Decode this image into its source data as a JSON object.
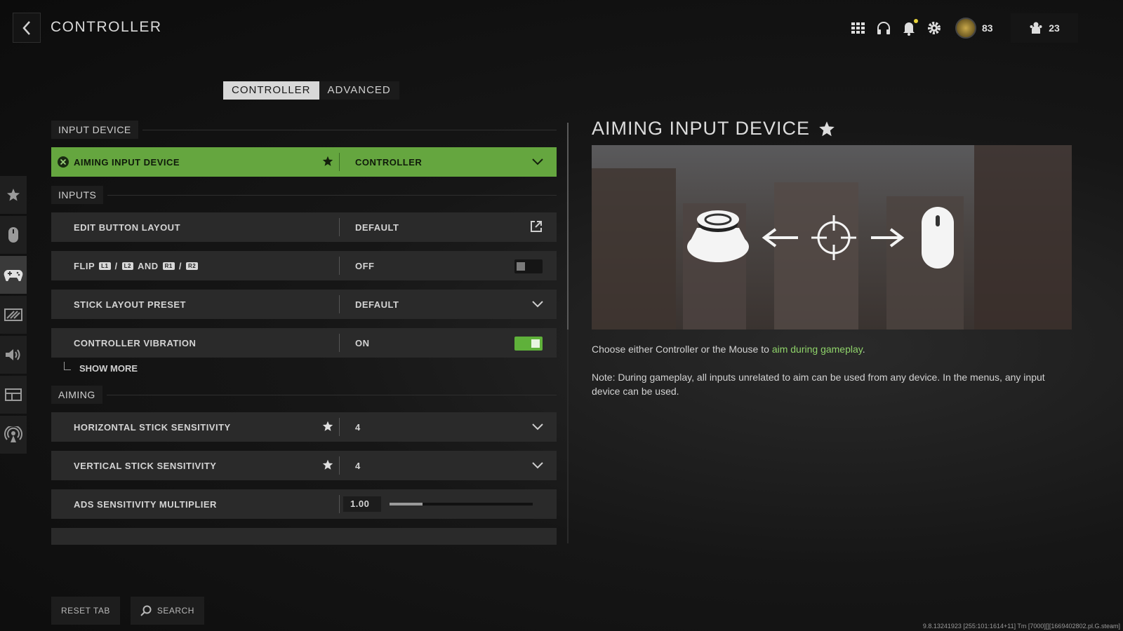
{
  "header": {
    "title": "CONTROLLER",
    "level": "83",
    "party_count": "23"
  },
  "tabs": [
    {
      "label": "CONTROLLER",
      "active": true
    },
    {
      "label": "ADVANCED",
      "active": false
    }
  ],
  "rail": [
    {
      "icon": "star-icon"
    },
    {
      "icon": "mouse-icon"
    },
    {
      "icon": "gamepad-icon",
      "active": true
    },
    {
      "icon": "display-icon"
    },
    {
      "icon": "speaker-icon"
    },
    {
      "icon": "interface-icon"
    },
    {
      "icon": "network-icon"
    }
  ],
  "sections": {
    "input_device": "INPUT DEVICE",
    "inputs": "INPUTS",
    "aiming": "AIMING"
  },
  "settings": {
    "aiming_input_device": {
      "label": "AIMING INPUT DEVICE",
      "value": "CONTROLLER"
    },
    "edit_button_layout": {
      "label": "EDIT BUTTON LAYOUT",
      "value": "DEFAULT"
    },
    "flip": {
      "prefix": "FLIP",
      "b1": "L1",
      "sep1": "/",
      "b2": "L2",
      "and": "AND",
      "b3": "R1",
      "sep2": "/",
      "b4": "R2",
      "value": "OFF"
    },
    "stick_layout_preset": {
      "label": "STICK LAYOUT PRESET",
      "value": "DEFAULT"
    },
    "controller_vibration": {
      "label": "CONTROLLER VIBRATION",
      "value": "ON"
    },
    "show_more": "SHOW MORE",
    "horizontal_stick_sensitivity": {
      "label": "HORIZONTAL STICK SENSITIVITY",
      "value": "4"
    },
    "vertical_stick_sensitivity": {
      "label": "VERTICAL STICK SENSITIVITY",
      "value": "4"
    },
    "ads_sensitivity_multiplier": {
      "label": "ADS SENSITIVITY MULTIPLIER",
      "value": "1.00",
      "slider_fraction": 0.23
    }
  },
  "bottom": {
    "reset_tab": "RESET TAB",
    "search": "SEARCH"
  },
  "detail": {
    "title": "AIMING INPUT DEVICE",
    "desc_prefix": "Choose either Controller or the Mouse to ",
    "desc_highlight": "aim during gameplay",
    "desc_suffix": ".",
    "note": "Note: During gameplay, all inputs unrelated to aim can be used from any device. In the menus, any input device can be used."
  },
  "version": "9.8.13241923 [255:101:1614+11] Tm [7000][][1669402802.pl.G.steam]",
  "colors": {
    "accent_green": "#65a63f",
    "highlight_text": "#8fd36a"
  }
}
